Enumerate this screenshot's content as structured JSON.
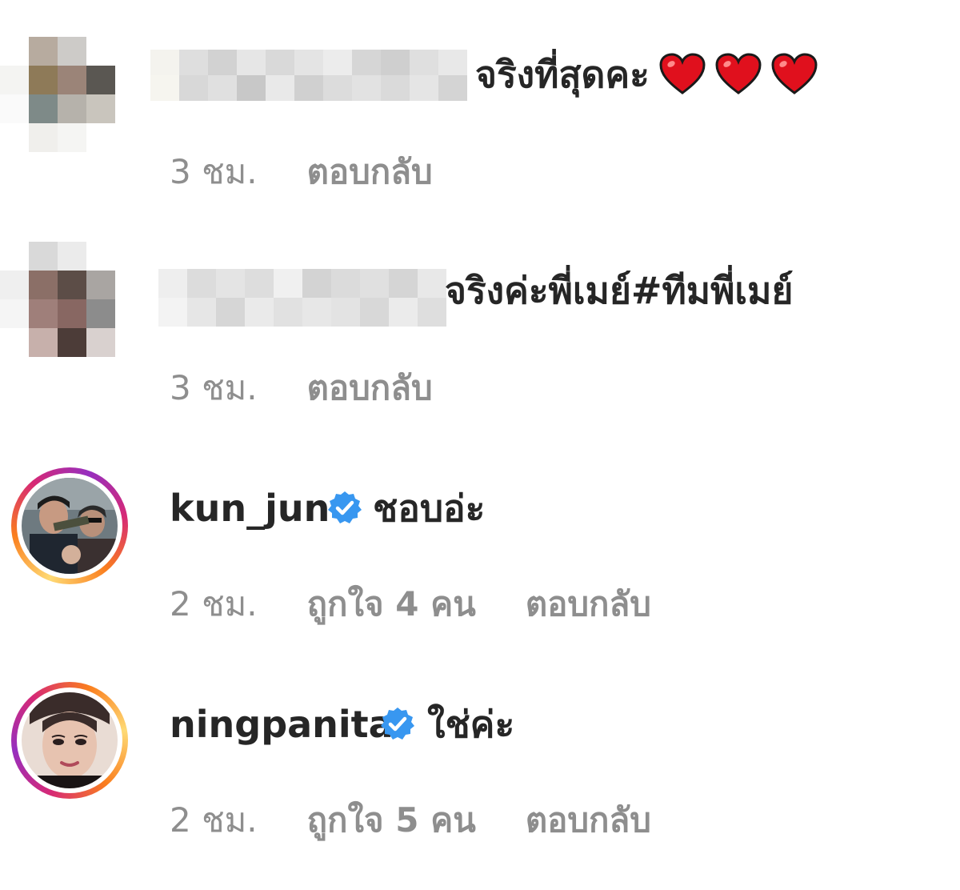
{
  "colors": {
    "text_primary": "#262626",
    "text_secondary": "#8e8e8e",
    "verified_blue": "#3897f0",
    "heart_red": "#e0101d"
  },
  "comments": [
    {
      "username": "",
      "username_blurred": true,
      "text": "จริงที่สุดคะ",
      "emoji": [
        "heart-icon",
        "heart-icon",
        "heart-icon"
      ],
      "time": "3 ชม.",
      "reply": "ตอบกลับ"
    },
    {
      "username": "",
      "username_blurred": true,
      "text": "จริงค่ะพี่เมย์#ทีมพี่เมย์",
      "time": "3 ชม.",
      "reply": "ตอบกลับ"
    },
    {
      "username": "kun_jun",
      "verified": true,
      "text": "ชอบอ่ะ",
      "time": "2 ชม.",
      "likes": "ถูกใจ 4 คน",
      "reply": "ตอบกลับ"
    },
    {
      "username": "ningpanita",
      "verified": true,
      "text": "ใช่ค่ะ",
      "time": "2 ชม.",
      "likes": "ถูกใจ 5 คน",
      "reply": "ตอบกลับ"
    }
  ]
}
